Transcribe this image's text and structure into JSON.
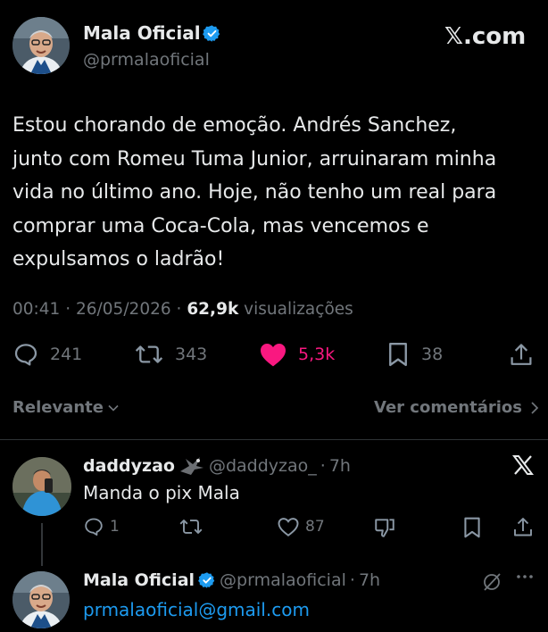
{
  "header": {
    "display_name": "Mala Oficial",
    "handle": "@prmalaoficial",
    "brand": "𝕏.com",
    "avatar_icon": "profile-photo",
    "verified_icon": "verified-badge-icon",
    "verified_color": "#1d9bf0"
  },
  "tweet": {
    "lines": [
      "Estou chorando de emoção. Andrés Sanchez,",
      "junto com Romeu Tuma Junior, arruinaram minha",
      "vida no último ano. Hoje, não tenho um real para",
      "comprar uma Coca-Cola, mas vencemos e",
      "expulsamos o ladrão!"
    ],
    "time": "00:41",
    "date": "26/05/2026",
    "views": "62,9k",
    "views_label": "visualizações",
    "sep": "·"
  },
  "actions": {
    "replies": "241",
    "reposts": "343",
    "likes": "5,3k",
    "bookmarks": "38",
    "like_color": "#f91880"
  },
  "filter": {
    "sort_label": "Relevante",
    "view_comments": "Ver comentários"
  },
  "reply": {
    "name": "daddyzao",
    "handle": "@daddyzao_",
    "time": "7h",
    "text": "Manda o pix Mala",
    "replies": "1",
    "likes": "87",
    "sep": "·"
  },
  "reply2": {
    "name": "Mala Oficial",
    "handle": "@prmalaoficial",
    "time": "7h",
    "text": "prmalaoficial@gmail.com",
    "link_color": "#1d9bf0",
    "sep": "·"
  }
}
